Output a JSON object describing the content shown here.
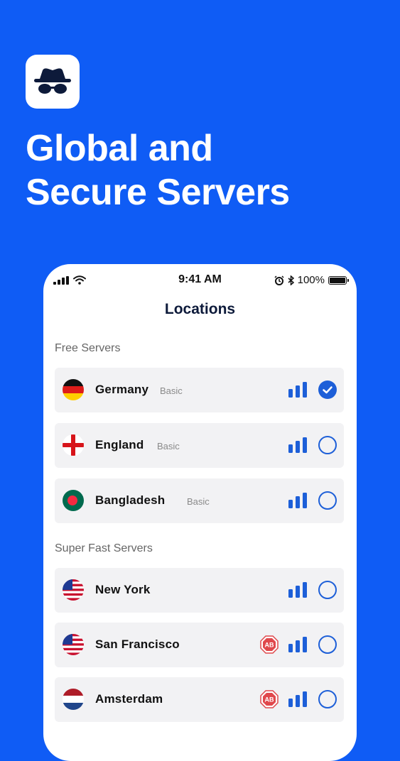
{
  "headline": {
    "line1": "Global and",
    "line2": "Secure Servers"
  },
  "status_bar": {
    "time": "9:41 AM",
    "battery": "100%"
  },
  "screen": {
    "title": "Locations",
    "sections": [
      {
        "label": "Free Servers",
        "items": [
          {
            "name": "Germany",
            "tag": "Basic",
            "flag": "germany",
            "selected": true
          },
          {
            "name": "England",
            "tag": "Basic",
            "flag": "england",
            "selected": false
          },
          {
            "name": "Bangladesh",
            "tag": "Basic",
            "flag": "bangladesh",
            "selected": false
          }
        ]
      },
      {
        "label": "Super Fast Servers",
        "items": [
          {
            "name": "New York",
            "flag": "usa",
            "selected": false,
            "ad_badge": false
          },
          {
            "name": "San Francisco",
            "flag": "usa",
            "selected": false,
            "ad_badge": true,
            "badge_text": "AB"
          },
          {
            "name": "Amsterdam",
            "flag": "netherlands",
            "selected": false,
            "ad_badge": true,
            "badge_text": "AB"
          }
        ]
      }
    ]
  },
  "colors": {
    "background": "#0f5cf5",
    "accent": "#1d5fd8"
  }
}
